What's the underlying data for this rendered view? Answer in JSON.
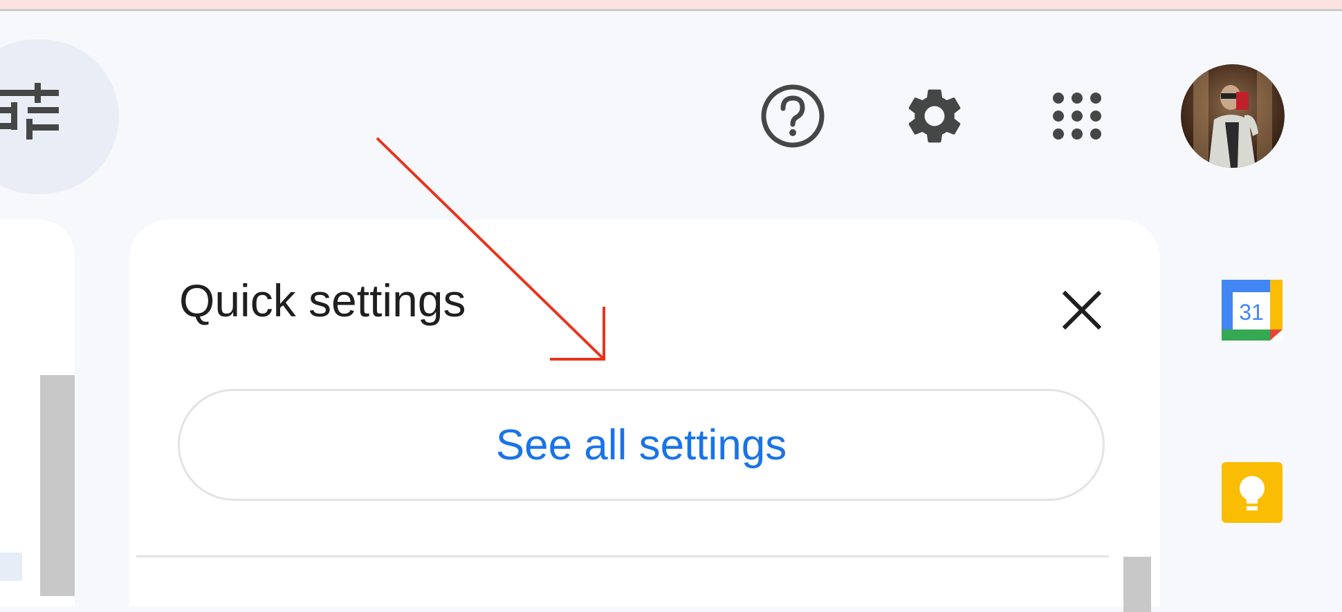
{
  "header": {
    "filter_icon": "tune-icon",
    "help_icon": "help-icon",
    "settings_icon": "gear-icon",
    "apps_icon": "apps-grid-icon",
    "avatar": "avatar"
  },
  "quick_settings": {
    "title": "Quick settings",
    "close_icon": "close-icon",
    "see_all_label": "See all settings"
  },
  "side_panel": {
    "calendar_date": "31",
    "calendar_icon": "calendar-icon",
    "keep_icon": "keep-icon"
  },
  "annotation": {
    "color": "#e8341c"
  },
  "colors": {
    "accent": "#1a73e8",
    "background": "#f6f8fc",
    "panel": "#ffffff"
  }
}
